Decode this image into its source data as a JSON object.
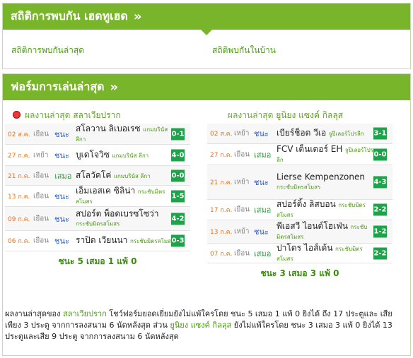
{
  "h2h": {
    "title": "สถิติการพบกัน เฮดทูเฮด",
    "chevron": "»",
    "link_recent": "สถิติการพบกันล่าสุด",
    "link_home": "สถิติพบกันในบ้าน"
  },
  "form": {
    "title": "ฟอร์มการเล่นล่าสุด",
    "chevron": "»",
    "left": {
      "label": "ผลงานล่าสุด",
      "team": "สลาเวียปราก",
      "summary": "ชนะ 5 เสมอ 1 แพ้ 0",
      "rows": [
        {
          "date": "02 ส.ค.",
          "venue": "เยือน",
          "result": "ชนะ",
          "kind": "win",
          "opp": "สโลวาน ลิเบอเรซ",
          "comp": "แกมบรินัส ลีกา",
          "score": "0-1"
        },
        {
          "date": "27 ก.ค.",
          "venue": "เหย้า",
          "result": "ชนะ",
          "kind": "win",
          "opp": "บูเดโจวิซ",
          "comp": "แกมบรินัส ลีกา",
          "score": "4-0"
        },
        {
          "date": "21 ก.ค.",
          "venue": "เยือน",
          "result": "เสมอ",
          "kind": "draw",
          "opp": "สโลวัคโค่",
          "comp": "แกมบรินัส ลีกา",
          "score": "0-0"
        },
        {
          "date": "13 ก.ค.",
          "venue": "เยือน",
          "result": "ชนะ",
          "kind": "win",
          "opp": "เอ็มเอสเค ซิลิน่า",
          "comp": "กระชับมิตรสโมสร",
          "score": "1-5"
        },
        {
          "date": "09 ก.ค.",
          "venue": "เยือน",
          "result": "ชนะ",
          "kind": "win",
          "opp": "สปอร์ต พ็อดเบรซโซว่า",
          "comp": "กระชับมิตรสโมสร",
          "score": "4-2"
        },
        {
          "date": "06 ก.ค.",
          "venue": "เยือน",
          "result": "ชนะ",
          "kind": "win",
          "opp": "ราปิด เวียนนา",
          "comp": "กระชับมิตรสโมสร",
          "score": "0-3"
        }
      ]
    },
    "right": {
      "label": "ผลงานล่าสุด",
      "team": "ยูนิยง แซงค์ กิลลุส",
      "summary": "ชนะ 3 เสมอ 3 แพ้ 0",
      "rows": [
        {
          "date": "02 ส.ค.",
          "venue": "เหย้า",
          "result": "ชนะ",
          "kind": "win",
          "opp": "เบียร์ช็อต วีเอ",
          "comp": "จูปิเลอร์โปรลีก",
          "score": "3-1"
        },
        {
          "date": "27 ก.ค.",
          "venue": "เยือน",
          "result": "เสมอ",
          "kind": "draw",
          "opp": "FCV เด็นเดอร์ EH",
          "comp": "จูปิเลอร์โปรลีก",
          "score": "0-0"
        },
        {
          "date": "21 ก.ค.",
          "venue": "เหย้า",
          "result": "ชนะ",
          "kind": "win",
          "opp": "Lierse Kempenzonen",
          "comp": "กระชับมิตรสโมสร",
          "score": "4-3"
        },
        {
          "date": "17 ก.ค.",
          "venue": "เยือน",
          "result": "เสมอ",
          "kind": "draw",
          "opp": "สปอร์ติ้ง ลิสบอน",
          "comp": "กระชับมิตรสโมสร",
          "score": "2-2"
        },
        {
          "date": "13 ก.ค.",
          "venue": "เหย้า",
          "result": "ชนะ",
          "kind": "win",
          "opp": "พีเอสวี ไอนด์โฮเฟ่น",
          "comp": "กระชับมิตรสโมสร",
          "score": "1-2"
        },
        {
          "date": "07 ก.ค.",
          "venue": "เยือน",
          "result": "เสมอ",
          "kind": "draw",
          "opp": "ปาโตร ไอส์เด้น",
          "comp": "กระชับมิตรสโมสร",
          "score": "2-2"
        }
      ]
    },
    "narrative": {
      "p1": "ผลงานล่าสุดของ ",
      "team1": "สลาเวียปราก",
      "p2": " โชว์ฟอร์มยอดเยี่ยมยังไม่แพ้ใครโดย ชนะ 5 เสมอ 1 แพ้ 0 ยิงได้ ถึง 17 ประตูและ เสีย เพียง 3 ประตู จากการลงสนาม 6 นัดหลังสุด ส่วน ",
      "team2": "ยูนิยง แซงค์ กิลลุส",
      "p3": " ยังไม่แพ้ใครโดย ชนะ 3 เสมอ 3 แพ้ 0 ยิงได้ 13 ประตูและเสีย 9 ประตู จากการลงสนาม 6 นัดหลังสุด"
    }
  },
  "colors": {
    "header": "#78b52a",
    "score_badge": "#1ea34a",
    "win": "#2a58b8",
    "draw": "#2a9b3a",
    "date": "#e8731c",
    "team_icon": "#e23b3b"
  }
}
